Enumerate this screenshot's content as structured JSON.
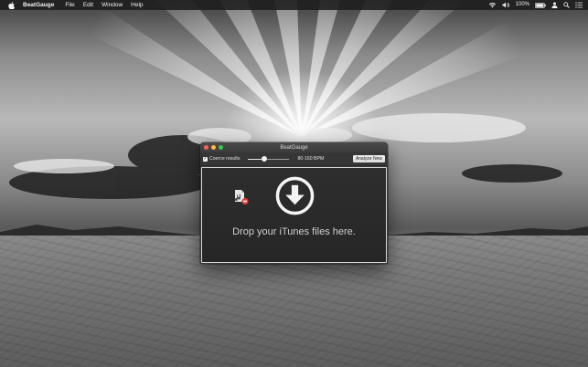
{
  "menubar": {
    "apple_icon": "apple-icon",
    "app_name": "BeatGauge",
    "items": [
      "File",
      "Edit",
      "Window",
      "Help"
    ],
    "battery_percent": "100%",
    "status_icons": [
      "wifi-icon",
      "volume-icon",
      "battery-icon",
      "user-icon",
      "search-icon",
      "list-icon"
    ]
  },
  "window": {
    "title": "BeatGauge",
    "toolbar": {
      "coerce_checked": true,
      "coerce_label": "Coerce results",
      "bpm_range_label": "80-160 BPM",
      "slider_level": 0.38,
      "analyze_button": "Analyze New"
    },
    "dropzone": {
      "message": "Drop your iTunes files here.",
      "icons": [
        "download-icon",
        "file-drag-icon"
      ]
    }
  },
  "colors": {
    "close": "#fc605c",
    "minimize": "#fdbc40",
    "zoom": "#34c84a"
  }
}
